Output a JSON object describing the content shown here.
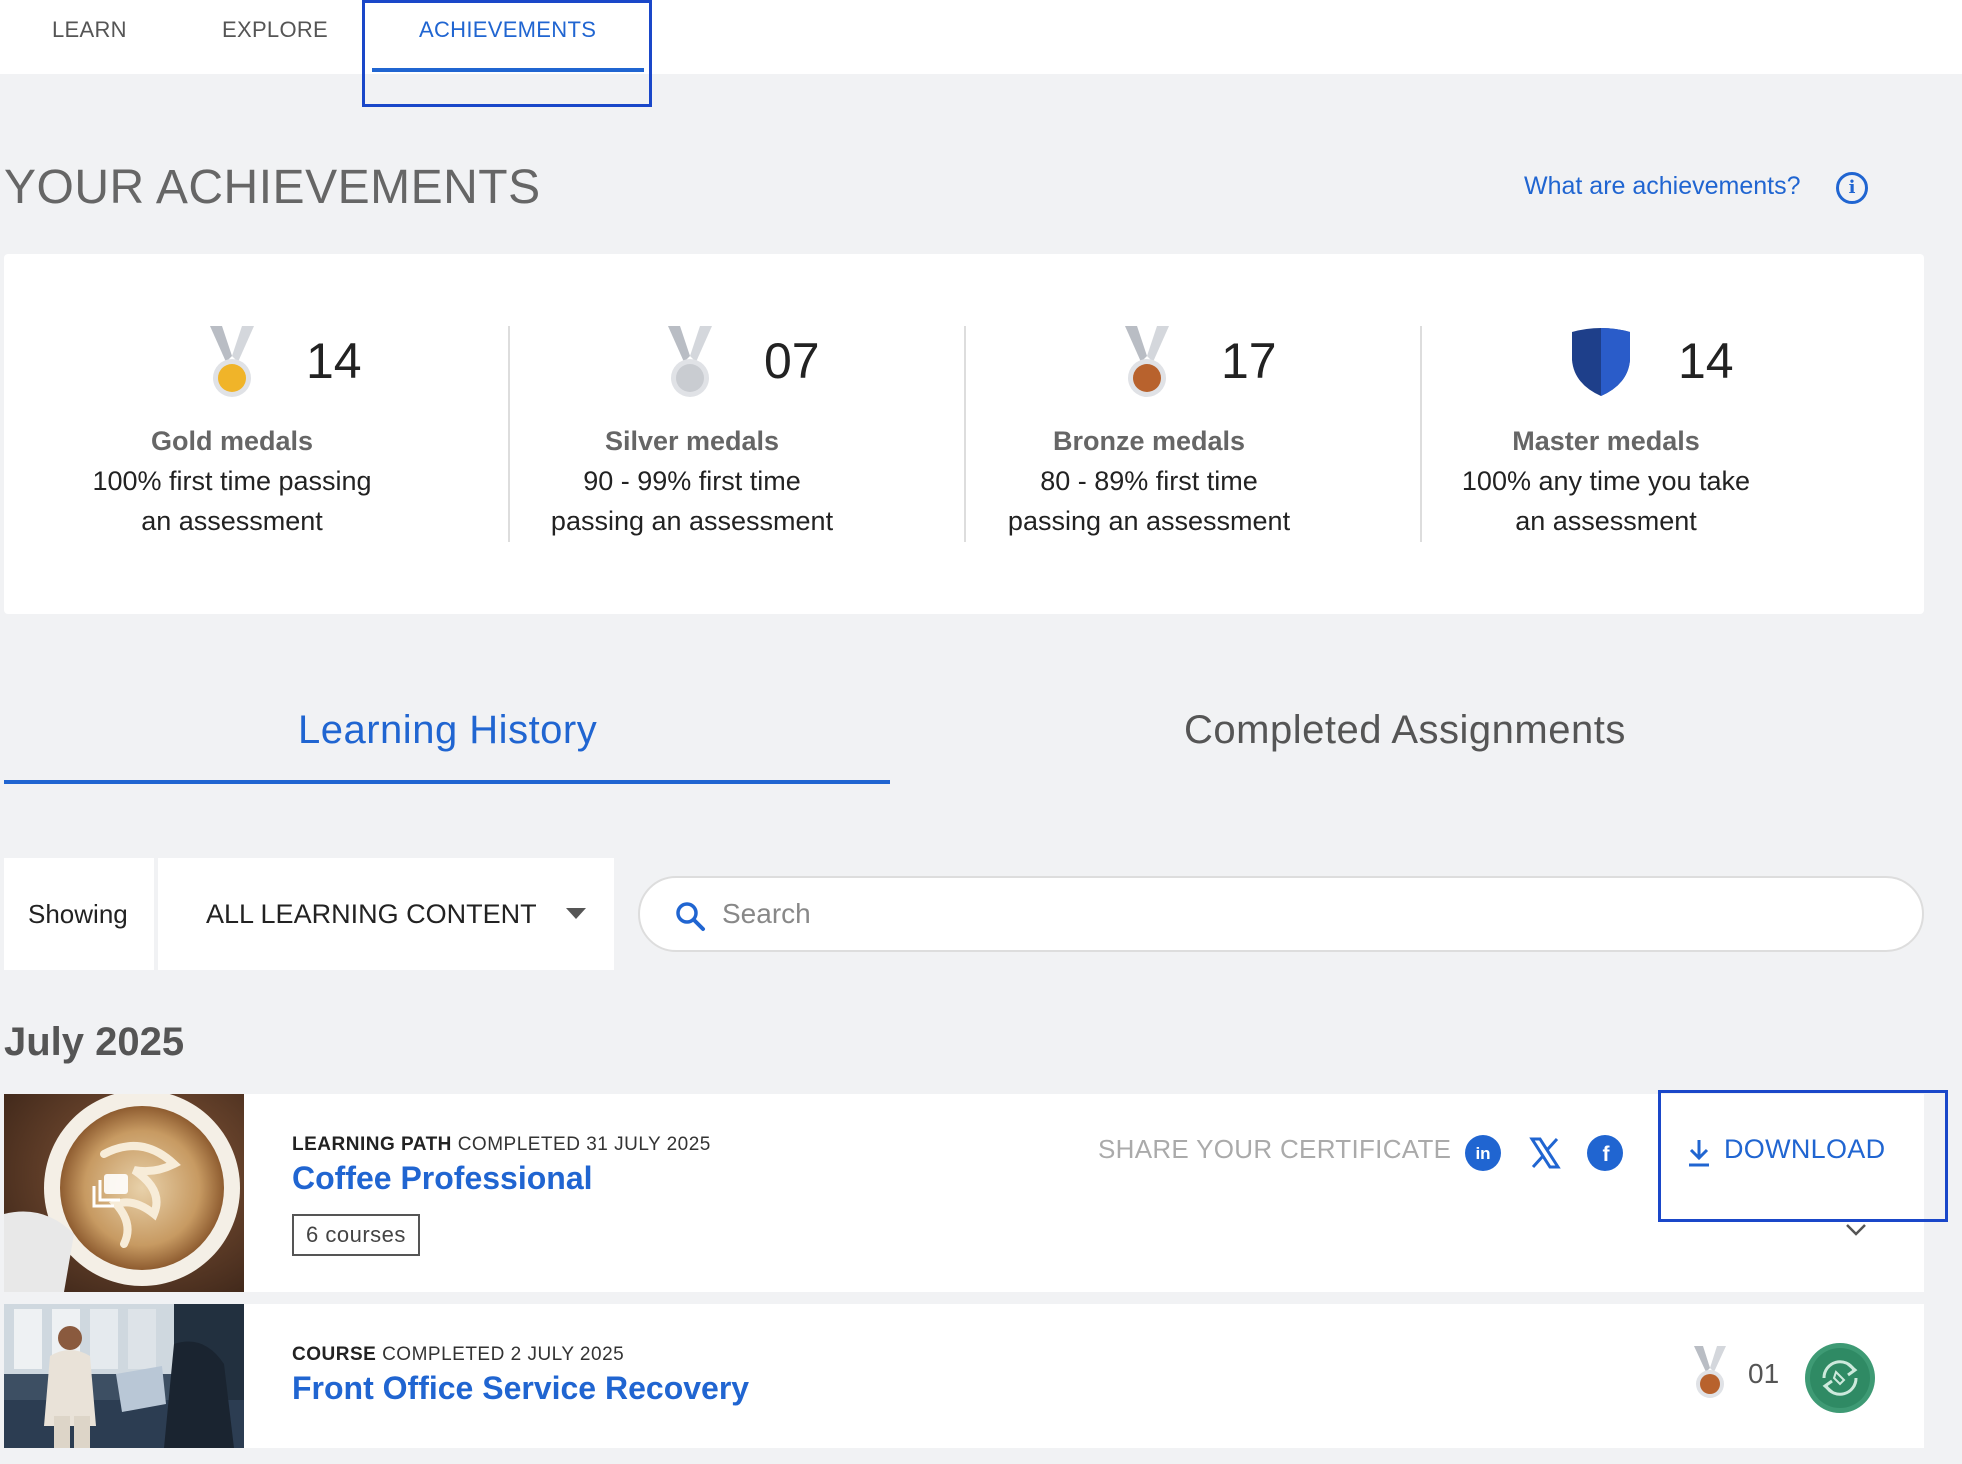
{
  "nav": {
    "tabs": [
      {
        "label": "LEARN"
      },
      {
        "label": "EXPLORE"
      },
      {
        "label": "ACHIEVEMENTS",
        "active": true
      }
    ]
  },
  "achievements": {
    "title": "YOUR ACHIEVEMENTS",
    "help_link": "What are achievements?",
    "medals": [
      {
        "count": "14",
        "name": "Gold medals",
        "desc_line1": "100% first time passing",
        "desc_line2": "an assessment",
        "color": "#f0b429"
      },
      {
        "count": "07",
        "name": "Silver medals",
        "desc_line1": "90 - 99% first time",
        "desc_line2": "passing an assessment",
        "color": "#c9ccd1"
      },
      {
        "count": "17",
        "name": "Bronze medals",
        "desc_line1": "80 - 89% first time",
        "desc_line2": "passing an assessment",
        "color": "#b8622d"
      },
      {
        "count": "14",
        "name": "Master medals",
        "desc_line1": "100% any time you take",
        "desc_line2": "an assessment",
        "color": "#2a5cc9"
      }
    ]
  },
  "content_tabs": [
    {
      "label": "Learning History",
      "active": true
    },
    {
      "label": "Completed Assignments"
    }
  ],
  "filter": {
    "showing_label": "Showing",
    "selected": "ALL LEARNING CONTENT",
    "search_placeholder": "Search"
  },
  "history": {
    "month": "July 2025",
    "items": [
      {
        "type": "LEARNING PATH",
        "completed": "COMPLETED 31 JULY 2025",
        "title": "Coffee Professional",
        "courses": "6 courses",
        "share_label": "SHARE YOUR CERTIFICATE",
        "download_label": "DOWNLOAD"
      },
      {
        "type": "COURSE",
        "completed": "COMPLETED 2 JULY 2025",
        "title": "Front Office Service Recovery",
        "medal_count": "01"
      }
    ]
  },
  "colors": {
    "accent": "#2065d1",
    "background": "#f1f2f4"
  }
}
